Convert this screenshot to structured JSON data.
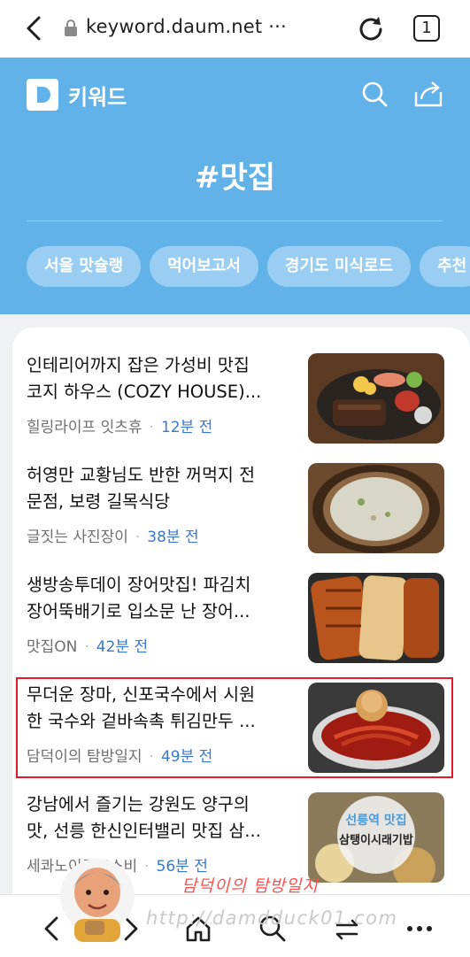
{
  "browser": {
    "url": "keyword.daum.net",
    "url_more": "···",
    "tab_count": "1"
  },
  "header": {
    "logo_letter": "D",
    "brand": "키워드",
    "keyword_title": "#맛집",
    "chips": [
      "서울 맛슐랭",
      "먹어보고서",
      "경기도 미식로드",
      "추천"
    ]
  },
  "articles": [
    {
      "title_l1": "인테리어까지 잡은 가성비 맛집",
      "title_l2": "코지 하우스 (COZY HOUSE)...",
      "source": "힐링라이프 잇츠휴",
      "time": "12분 전",
      "thumb": "steak-platter"
    },
    {
      "title_l1": "허영만 교황님도 반한 꺼먹지 전",
      "title_l2": "문점, 보령 길목식당",
      "source": "글짓는 사진장이",
      "time": "38분 전",
      "thumb": "soup-bowl"
    },
    {
      "title_l1": "생방송투데이 장어맛집! 파김치",
      "title_l2": "장어뚝배기로 입소문 난 장어...",
      "source": "맛집ON",
      "time": "42분 전",
      "thumb": "grilled-eel"
    },
    {
      "title_l1": "무더운 장마, 신포국수에서 시원",
      "title_l2": "한 국수와 겉바속촉 튀김만두 ...",
      "source": "담덕이의 탐방일지",
      "time": "49분 전",
      "thumb": "cold-noodles"
    },
    {
      "title_l1": "강남에서 즐기는 강원도 양구의",
      "title_l2": "맛, 선릉 한신인터밸리 맛집 삼...",
      "source": "세콰노이로모스비",
      "time": "56분 전",
      "thumb": "restaurant-card",
      "thumb_text1": "선릉역 맛집",
      "thumb_text2": "삼탱이시래기밥"
    }
  ],
  "watermark": {
    "title": "담덕이의 탐방일지",
    "url": "http://damdduck01.com"
  },
  "colors": {
    "header_bg": "#62b2ea",
    "chip_bg": "#9acdf2",
    "time_text": "#3a78c9",
    "highlight_border": "#e21b2a"
  }
}
